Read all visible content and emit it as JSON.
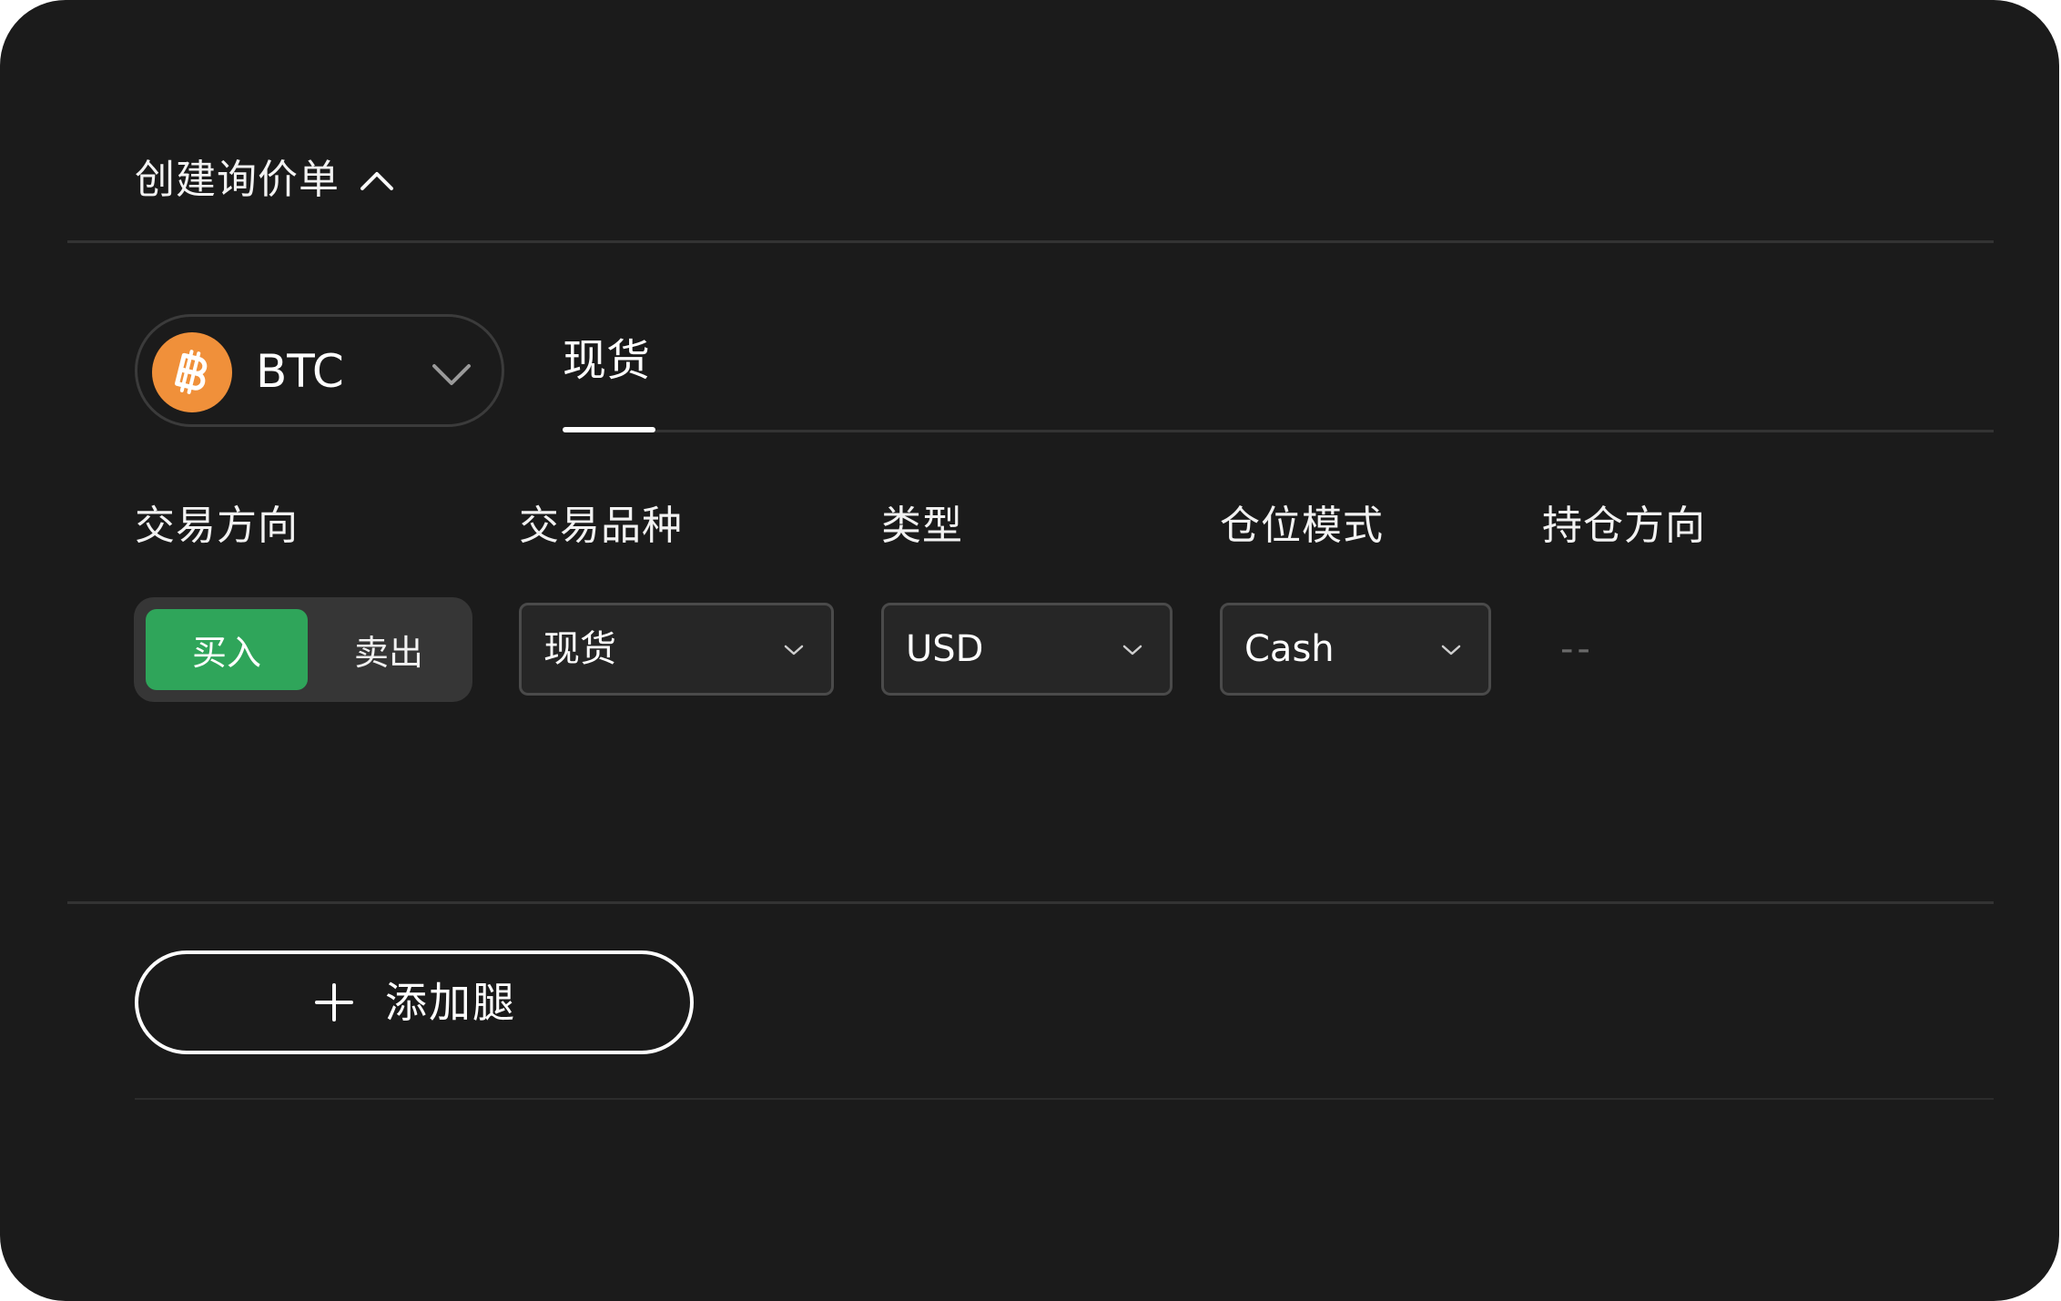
{
  "header": {
    "title": "创建询价单",
    "toggle_icon": "chevron-up-icon"
  },
  "asset": {
    "symbol": "BTC",
    "icon": "bitcoin-icon",
    "icon_color": "#F0903A",
    "dropdown_icon": "chevron-down-icon"
  },
  "tabs": [
    {
      "label": "现货",
      "active": true
    }
  ],
  "fields": {
    "direction": {
      "label": "交易方向",
      "options": [
        "买入",
        "卖出"
      ],
      "selected": "买入",
      "selected_color": "#2FA55A"
    },
    "product": {
      "label": "交易品种",
      "value": "现货"
    },
    "type": {
      "label": "类型",
      "value": "USD"
    },
    "margin_mode": {
      "label": "仓位模式",
      "value": "Cash"
    },
    "position_side": {
      "label": "持仓方向",
      "value": "--"
    }
  },
  "add_leg": {
    "label": "添加腿",
    "icon": "plus-icon"
  }
}
